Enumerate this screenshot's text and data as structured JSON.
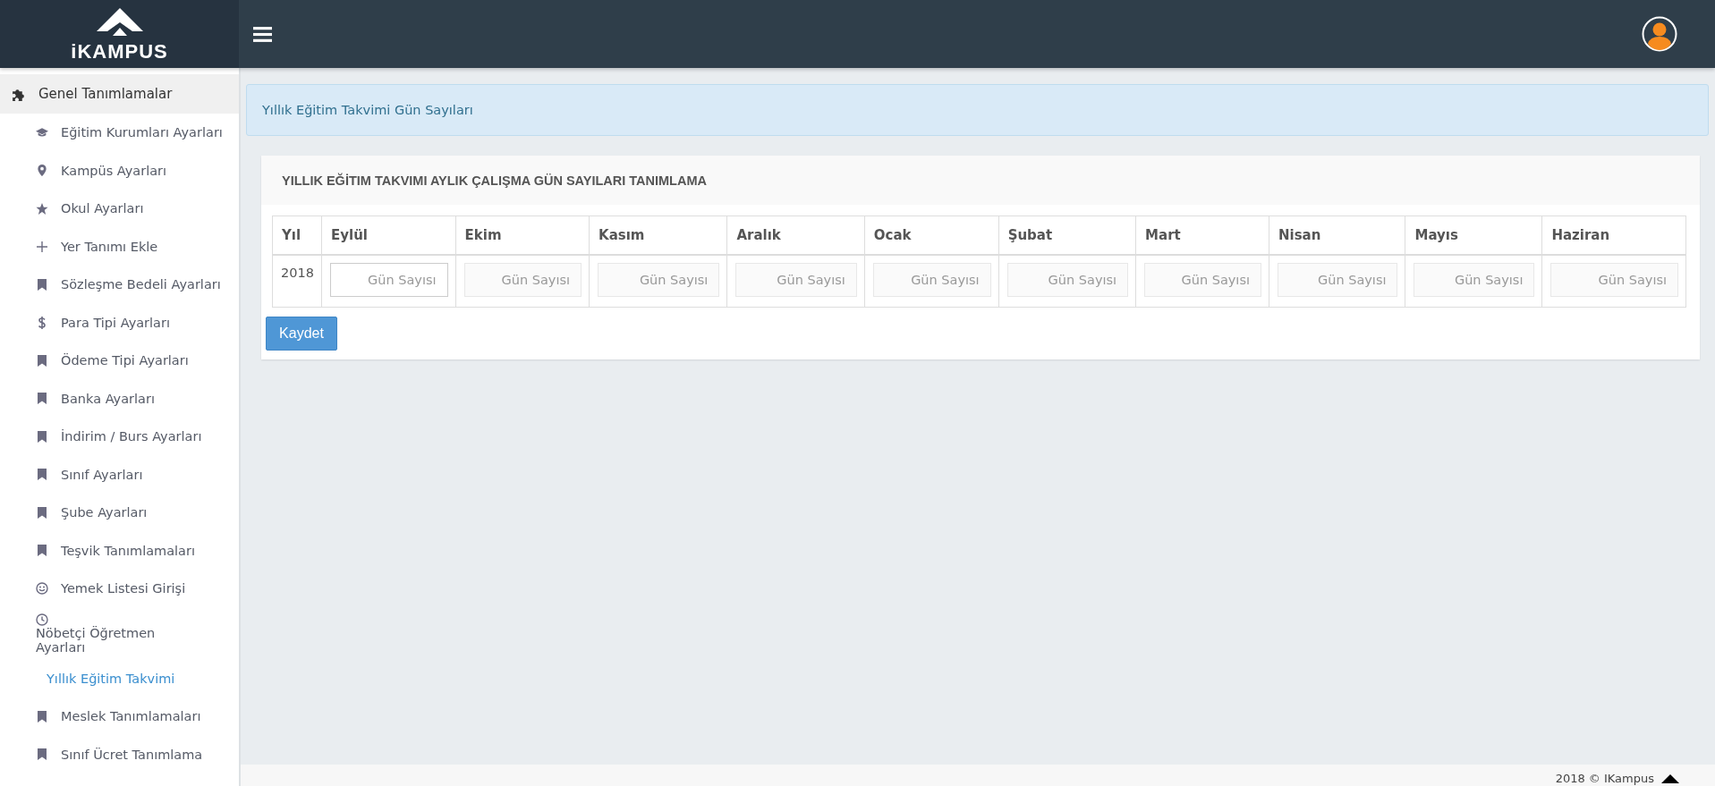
{
  "brand": {
    "logo_text": "iKAMPUS"
  },
  "sidebar": {
    "items": [
      {
        "label": "Genel Tanımlamalar",
        "expanded": true,
        "children": [
          {
            "label": "Eğitim Kurumları Ayarları",
            "selected": false
          },
          {
            "label": "Kampüs Ayarları",
            "selected": false
          },
          {
            "label": "Okul Ayarları",
            "selected": false
          },
          {
            "label": "Yer Tanımı Ekle",
            "selected": false
          },
          {
            "label": "Sözleşme Bedeli Ayarları",
            "selected": false
          },
          {
            "label": "Para Tipi Ayarları",
            "selected": false
          },
          {
            "label": "Ödeme Tipi Ayarları",
            "selected": false
          },
          {
            "label": "Banka Ayarları",
            "selected": false
          },
          {
            "label": "İndirim / Burs Ayarları",
            "selected": false
          },
          {
            "label": "Sınıf Ayarları",
            "selected": false
          },
          {
            "label": "Şube Ayarları",
            "selected": false
          },
          {
            "label": "Teşvik Tanımlamaları",
            "selected": false
          },
          {
            "label": "Yemek Listesi Girişi",
            "selected": false
          },
          {
            "label": "Nöbetçi Öğretmen Ayarları",
            "selected": false
          },
          {
            "label": "Yıllık Eğitim Takvimi",
            "selected": true
          },
          {
            "label": "Meslek Tanımlamaları",
            "selected": false
          },
          {
            "label": "Sınıf Ücret Tanımlama",
            "selected": false
          }
        ]
      }
    ]
  },
  "breadcrumb": "Yıllık Eğitim Takvimi Gün Sayıları",
  "card": {
    "title": "YILLIK EĞİTIM TAKVIMI AYLIK ÇALIŞMA GÜN SAYILARI TANIMLAMA",
    "table": {
      "columns": [
        "Yıl",
        "Eylül",
        "Ekim",
        "Kasım",
        "Aralık",
        "Ocak",
        "Şubat",
        "Mart",
        "Nisan",
        "Mayıs",
        "Haziran"
      ],
      "rows": [
        {
          "year": "2018",
          "inputs": [
            {
              "placeholder": "Gün Sayısı",
              "focused": true
            },
            {
              "placeholder": "Gün Sayısı",
              "focused": false
            },
            {
              "placeholder": "Gün Sayısı",
              "focused": false
            },
            {
              "placeholder": "Gün Sayısı",
              "focused": false
            },
            {
              "placeholder": "Gün Sayısı",
              "focused": false
            },
            {
              "placeholder": "Gün Sayısı",
              "focused": false
            },
            {
              "placeholder": "Gün Sayısı",
              "focused": false
            },
            {
              "placeholder": "Gün Sayısı",
              "focused": false
            },
            {
              "placeholder": "Gün Sayısı",
              "focused": false
            },
            {
              "placeholder": "Gün Sayısı",
              "focused": false
            }
          ]
        }
      ]
    },
    "save_button": "Kaydet"
  },
  "footer": "2018 © IKampus"
}
